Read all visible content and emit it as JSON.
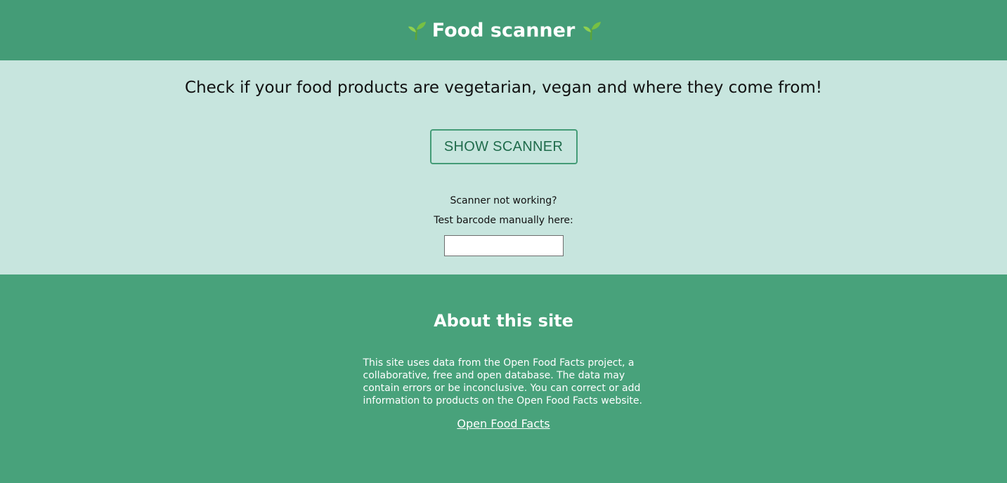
{
  "header": {
    "title": "Food scanner",
    "icon_left": "seedling-icon",
    "icon_right": "seedling-icon"
  },
  "main": {
    "tagline": "Check if your food products are vegetarian, vegan and where they come from!",
    "show_scanner_label": "SHOW SCANNER",
    "help_line_1": "Scanner not working?",
    "help_line_2": "Test barcode manually here:",
    "barcode_value": "",
    "barcode_placeholder": ""
  },
  "about": {
    "title": "About this site",
    "text": "This site uses data from the Open Food Facts project, a collaborative, free and open database. The data may contain errors or be inconclusive. You can correct or add information to products on the Open Food Facts website.",
    "link_label": "Open Food Facts"
  },
  "colors": {
    "header_bg": "#449c77",
    "main_bg": "#c7e5de",
    "about_bg": "#48a27b",
    "button_border": "#449c77",
    "button_text": "#1f6b4b"
  }
}
